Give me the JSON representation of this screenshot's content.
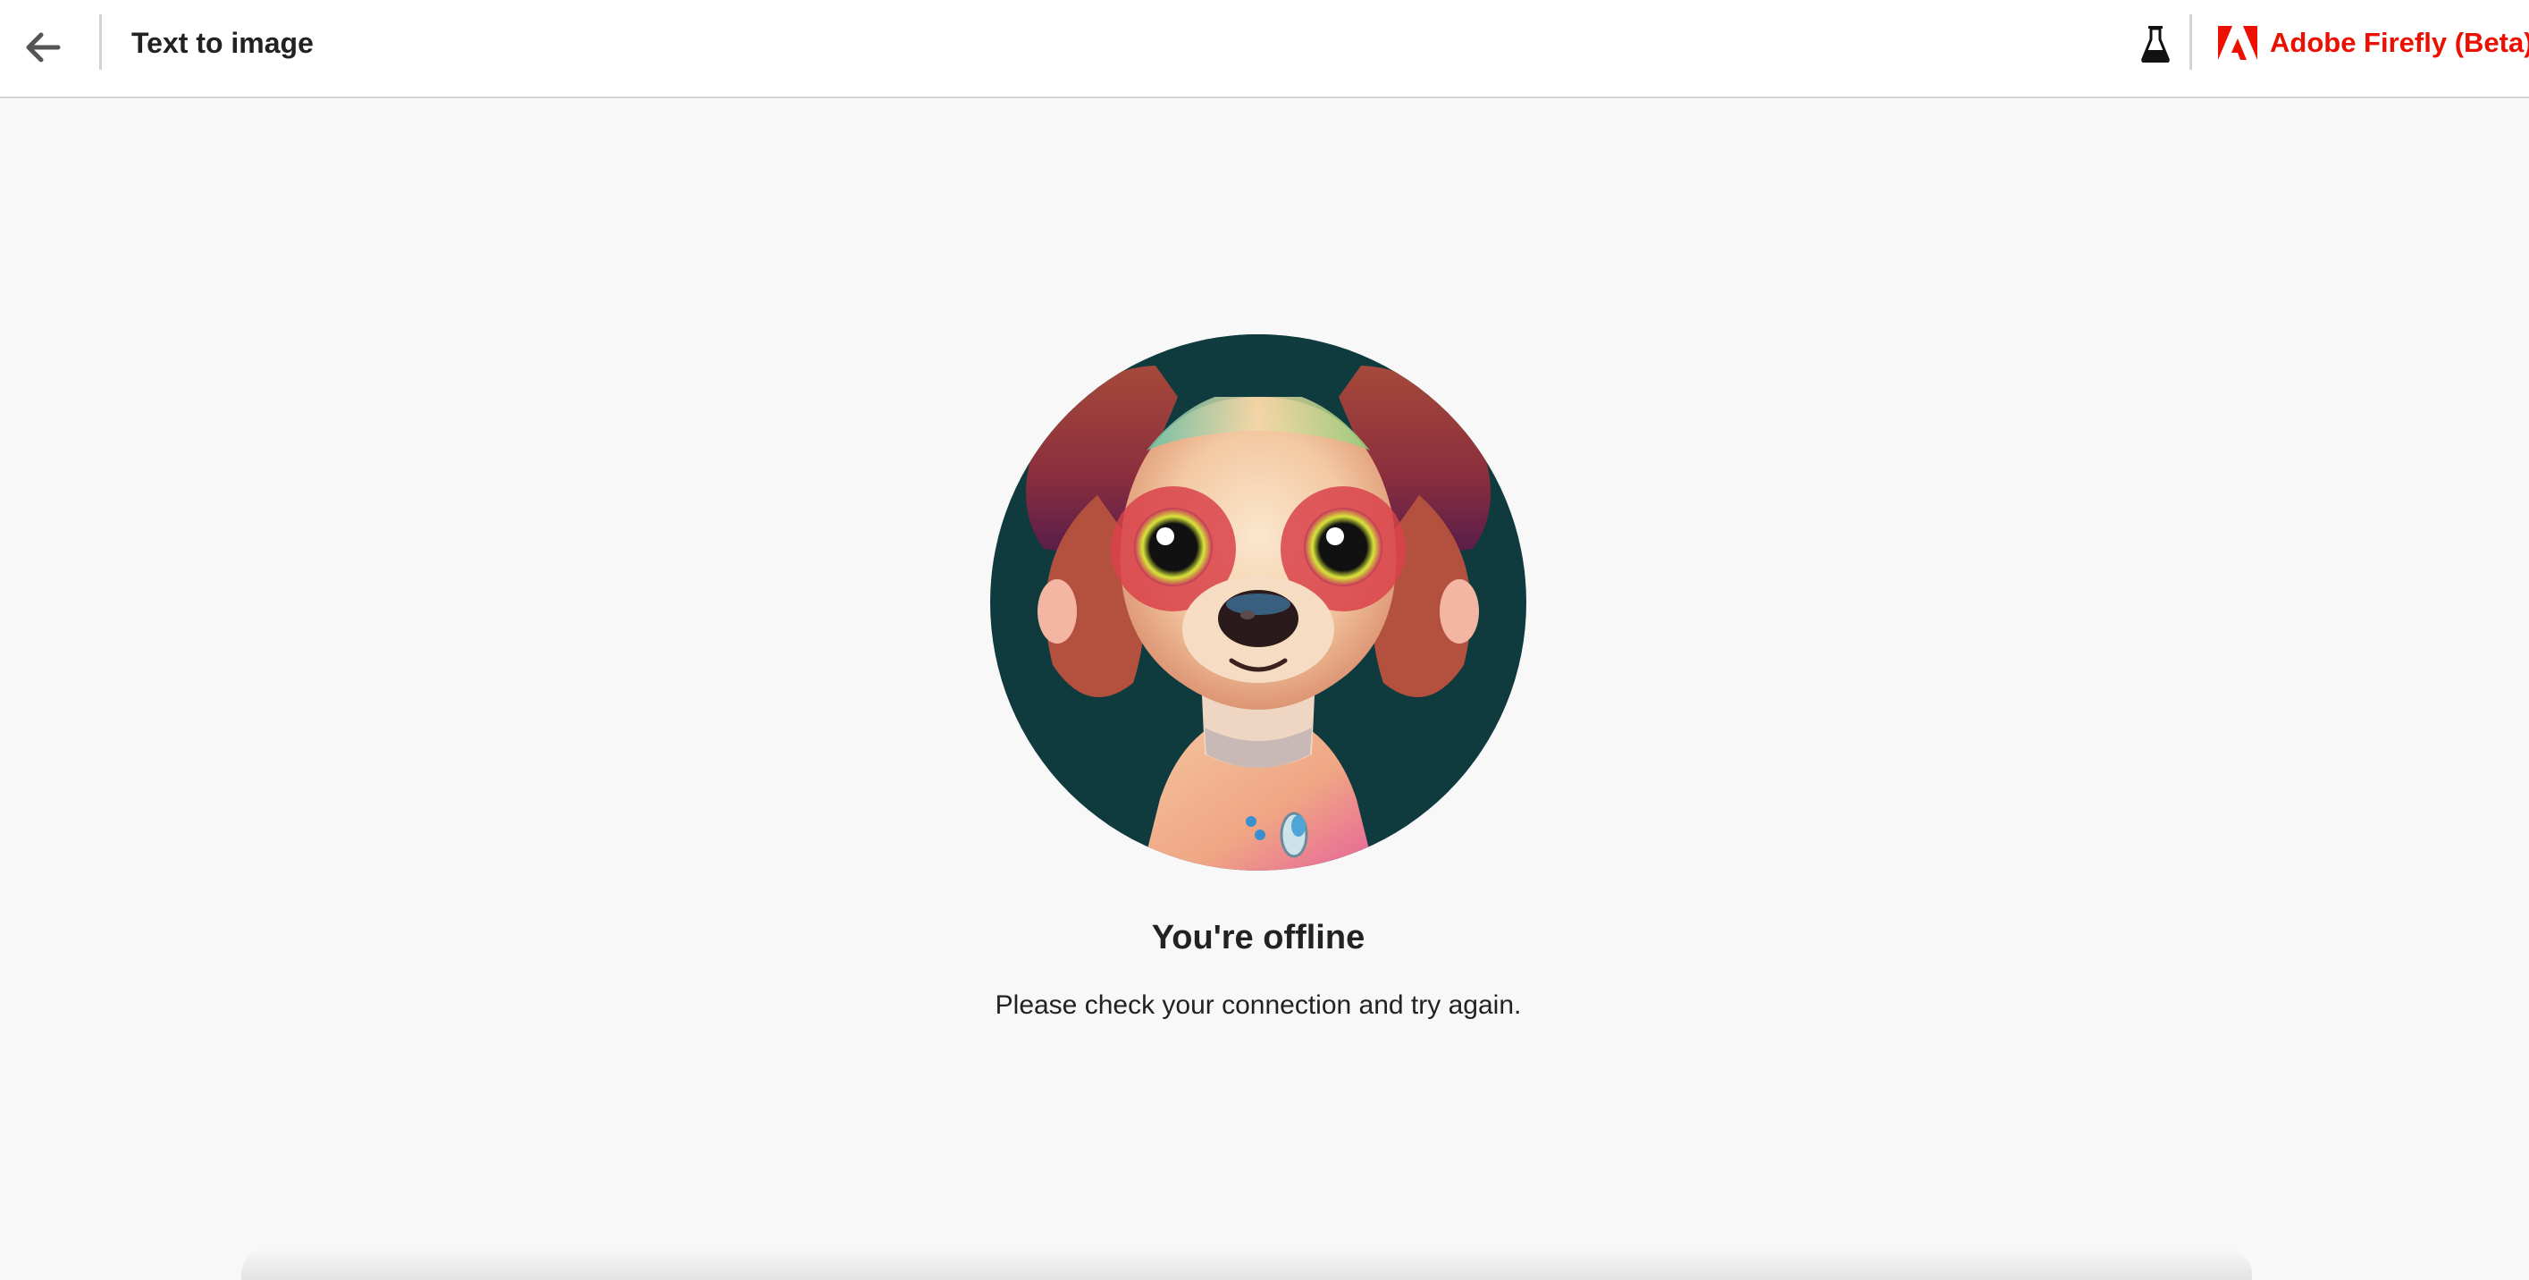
{
  "header": {
    "back_icon": "arrow-left-icon",
    "title": "Text to image",
    "flask_icon": "flask-icon",
    "brand_logo_icon": "adobe-logo-icon",
    "brand_name": "Adobe Firefly (Beta)"
  },
  "offline": {
    "illustration_icon": "puppy-illustration",
    "title": "You're offline",
    "message": "Please check your connection and try again."
  },
  "colors": {
    "brand_red": "#eb1000",
    "page_background": "#f8f8f8",
    "header_background": "#ffffff",
    "text_primary": "#222222"
  }
}
